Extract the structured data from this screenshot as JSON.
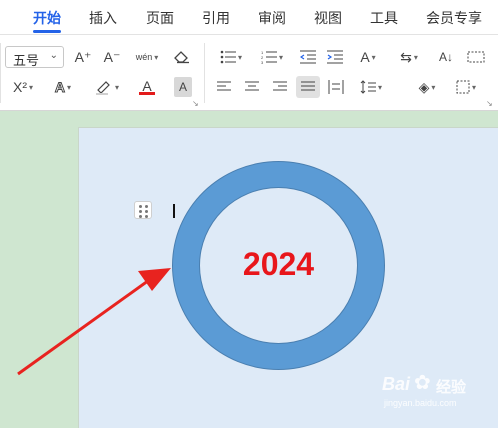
{
  "tabs": [
    {
      "label": "开始",
      "active": true
    },
    {
      "label": "插入"
    },
    {
      "label": "页面"
    },
    {
      "label": "引用"
    },
    {
      "label": "审阅"
    },
    {
      "label": "视图"
    },
    {
      "label": "工具"
    },
    {
      "label": "会员专享"
    }
  ],
  "ribbon": {
    "font_size": "五号",
    "superscript": "X²",
    "font_color_label": "A",
    "highlight_label": "A",
    "increase_font": "A⁺",
    "decrease_font": "A⁻",
    "phonetic": "wén",
    "text_effect": "A",
    "char_shading": "A",
    "accent_red": "#e31b1b",
    "accent_blue": "#2463e8"
  },
  "document": {
    "shape_text": "2024",
    "shape_fill": "#5b9bd5",
    "text_color": "#e8161b"
  },
  "watermark": {
    "brand": "Bai",
    "product": "经验",
    "url": "jingyan.baidu.com"
  }
}
